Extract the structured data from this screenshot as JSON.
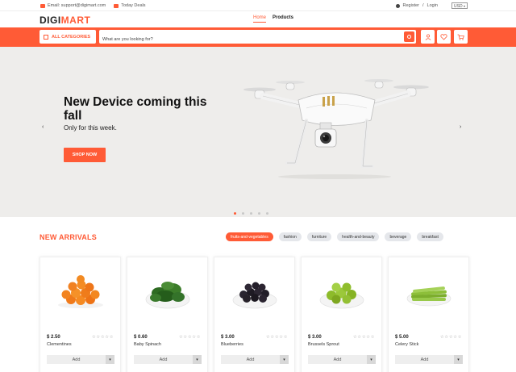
{
  "topbar": {
    "email": "Email: support@digimart.com",
    "deals": "Today Deals",
    "register": "Register",
    "separator": "/",
    "login": "Login",
    "currency": "USD"
  },
  "header": {
    "logo_main": "DIGI",
    "logo_accent": "MART",
    "nav": [
      {
        "label": "Home",
        "active": true
      },
      {
        "label": "Products",
        "active": false
      }
    ]
  },
  "search": {
    "categories_label": "ALL CATEGORIES",
    "placeholder": "What are you looking for?"
  },
  "hero": {
    "title": "New Device coming this fall",
    "subtitle": "Only for this week.",
    "button": "SHOP NOW",
    "prev": "‹",
    "next": "›",
    "slide_count": 5,
    "active_slide": 1
  },
  "arrivals": {
    "title": "NEW ARRIVALS",
    "filters": [
      {
        "label": "fruits-and-vegetables",
        "active": true
      },
      {
        "label": "fashion",
        "active": false
      },
      {
        "label": "furniture",
        "active": false
      },
      {
        "label": "health-and-beauty",
        "active": false
      },
      {
        "label": "beverage",
        "active": false
      },
      {
        "label": "breakfast",
        "active": false
      }
    ],
    "products": [
      {
        "price": "$ 2.50",
        "name": "Clementines",
        "add": "Add",
        "more": "▾",
        "stars": "☆☆☆☆☆"
      },
      {
        "price": "$ 0.60",
        "name": "Baby Spinach",
        "add": "Add",
        "more": "▾",
        "stars": "☆☆☆☆☆"
      },
      {
        "price": "$ 3.00",
        "name": "Blueberries",
        "add": "Add",
        "more": "▾",
        "stars": "☆☆☆☆☆"
      },
      {
        "price": "$ 3.00",
        "name": "Brussels Sprout",
        "add": "Add",
        "more": "▾",
        "stars": "☆☆☆☆☆"
      },
      {
        "price": "$ 5.00",
        "name": "Celery Stick",
        "add": "Add",
        "more": "▾",
        "stars": "☆☆☆☆☆"
      }
    ]
  },
  "colors": {
    "accent": "#ff5b36",
    "hero_bg": "#eeedeb",
    "chip_bg": "#e5e7eb"
  }
}
